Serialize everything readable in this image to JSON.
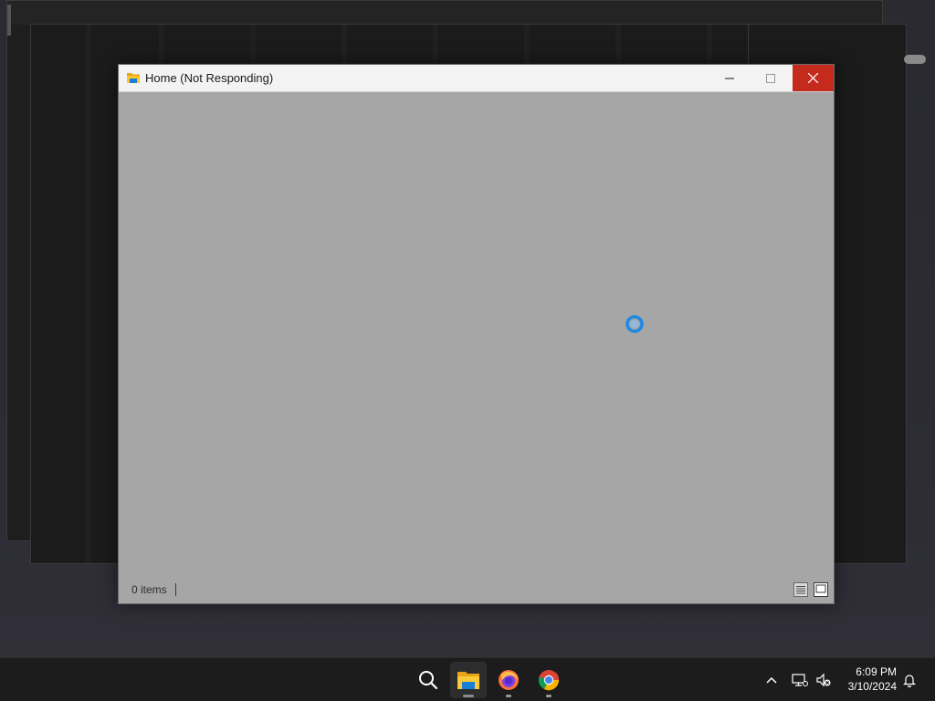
{
  "window": {
    "title": "Home (Not Responding)",
    "content_bg": "#a6a6a6",
    "close_color": "#c42b1c"
  },
  "statusbar": {
    "item_count": "0 items"
  },
  "taskbar": {
    "pinned": [
      {
        "name": "search-icon"
      },
      {
        "name": "file-explorer-icon",
        "active": true
      },
      {
        "name": "firefox-icon"
      },
      {
        "name": "chrome-icon"
      }
    ],
    "tray_icons": [
      "chevron-up-icon",
      "network-icon",
      "volume-muted-icon",
      "notification-bell-icon"
    ]
  },
  "clock": {
    "time": "6:09 PM",
    "date": "3/10/2024"
  }
}
